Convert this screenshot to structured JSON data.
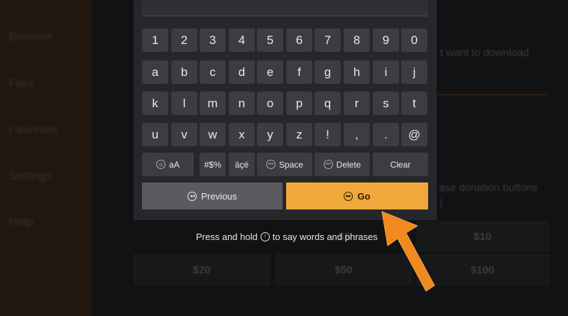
{
  "sidebar": {
    "items": [
      "Browser",
      "Files",
      "Favorites",
      "Settings",
      "Help"
    ]
  },
  "background": {
    "line1": "t want to download",
    "line2": "ase donation buttons",
    "line2b": "j",
    "tiles": [
      "$5",
      "$10",
      "$20",
      "$50",
      "$100"
    ]
  },
  "keyboard": {
    "rows": [
      [
        "1",
        "2",
        "3",
        "4",
        "5",
        "6",
        "7",
        "8",
        "9",
        "0"
      ],
      [
        "a",
        "b",
        "c",
        "d",
        "e",
        "f",
        "g",
        "h",
        "i",
        "j"
      ],
      [
        "k",
        "l",
        "m",
        "n",
        "o",
        "p",
        "q",
        "r",
        "s",
        "t"
      ],
      [
        "u",
        "v",
        "w",
        "x",
        "y",
        "z",
        "!",
        ",",
        ".",
        "@"
      ]
    ],
    "func_keys": {
      "case": "aA",
      "symbols": "#$%",
      "accents": "äçé",
      "space": "Space",
      "delete": "Delete",
      "clear": "Clear"
    },
    "previous_label": "Previous",
    "go_label": "Go"
  },
  "hint": {
    "before": "Press and hold",
    "after": "to say words and phrases"
  },
  "colors": {
    "accent": "#f0a83b",
    "arrow": "#f08a1e"
  }
}
